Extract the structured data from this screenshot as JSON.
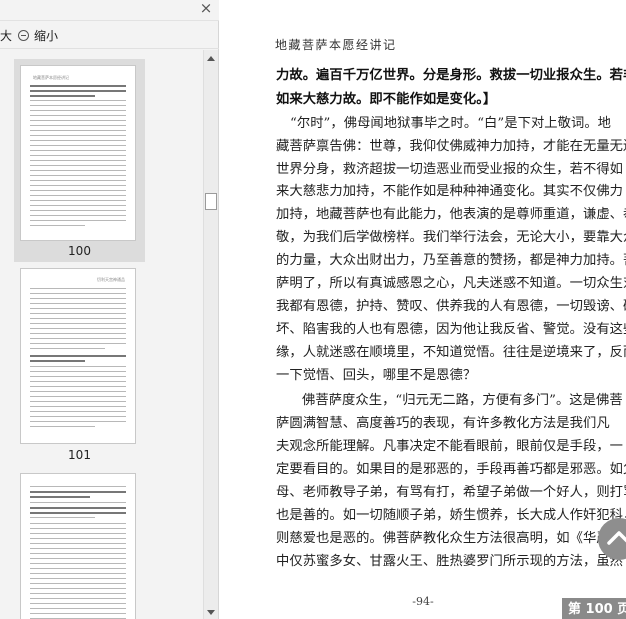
{
  "sidebar": {
    "close_label": "×",
    "zoom_in_label": "大",
    "zoom_out_label": "缩小",
    "thumbnails": [
      {
        "label": "100",
        "header": "地藏菩萨本愿经讲记"
      },
      {
        "label": "101",
        "header": "忉利天宫神通品"
      },
      {
        "label": "",
        "header": ""
      }
    ]
  },
  "page": {
    "header": "地藏菩萨本愿经讲记",
    "lines": [
      "力故。遍百千万亿世界。分是身形。救拔一切业报众生。若非",
      "如来大慈力故。即不能作如是变化。】",
      "“尔时”，佛母闻地狱事毕之时。“白”是下对上敬词。地",
      "藏菩萨禀告佛：世尊，我仰仗佛威神力加持，才能在无量无边",
      "世界分身，救济超拔一切造恶业而受业报的众生，若不得如",
      "来大慈悲力加持，不能作如是种种神通变化。其实不仅佛力",
      "加持，地藏菩萨也有此能力，他表演的是尊师重道，谦虚、恭",
      "敬，为我们后学做榜样。我们举行法会，无论大小，要靠大众",
      "的力量，大众出财出力，乃至善意的赞扬，都是神力加持。菩",
      "萨明了，所以有真诚感恩之心，凡夫迷惑不知道。一切众生对",
      "我都有恩德，护持、赞叹、供养我的人有恩德，一切毁谤、破",
      "坏、陷害我的人也有恩德，因为他让我反省、警觉。没有这些逆",
      "缘，人就迷惑在顺境里，不知道觉悟。往往是逆境来了，反而能",
      "一下觉悟、回头，哪里不是恩德？",
      "佛菩萨度众生，“归元无二路，方便有多门”。这是佛菩",
      "萨圆满智慧、高度善巧的表现，有许多教化方法是我们凡",
      "夫观念所能理解。凡事决定不能看眼前，眼前仅是手段，一",
      "定要看目的。如果目的是邪恶的，手段再善巧都是邪恶。如父",
      "母、老师教导子弟，有骂有打，希望子弟做一个好人，则打骂",
      "也是善的。如一切随顺子弟，娇生惯养，长大成人作奸犯科，",
      "则慈爱也是恶的。佛菩萨教化众生方法很高明，如《华严经》",
      "中仅苏蜜多女、甘露火王、胜热婆罗门所示现的方法，虽然"
    ],
    "page_number": "-94-",
    "current_page_indicator": "第 100 页"
  },
  "icons": {
    "close": "close-icon",
    "zoom_out": "zoom-out-icon",
    "back_to_top": "back-to-top-icon"
  },
  "colors": {
    "panel_bg": "#f3f3f3",
    "selected_thumb": "#dcdcdc",
    "back_to_top": "#8e8e8e"
  }
}
